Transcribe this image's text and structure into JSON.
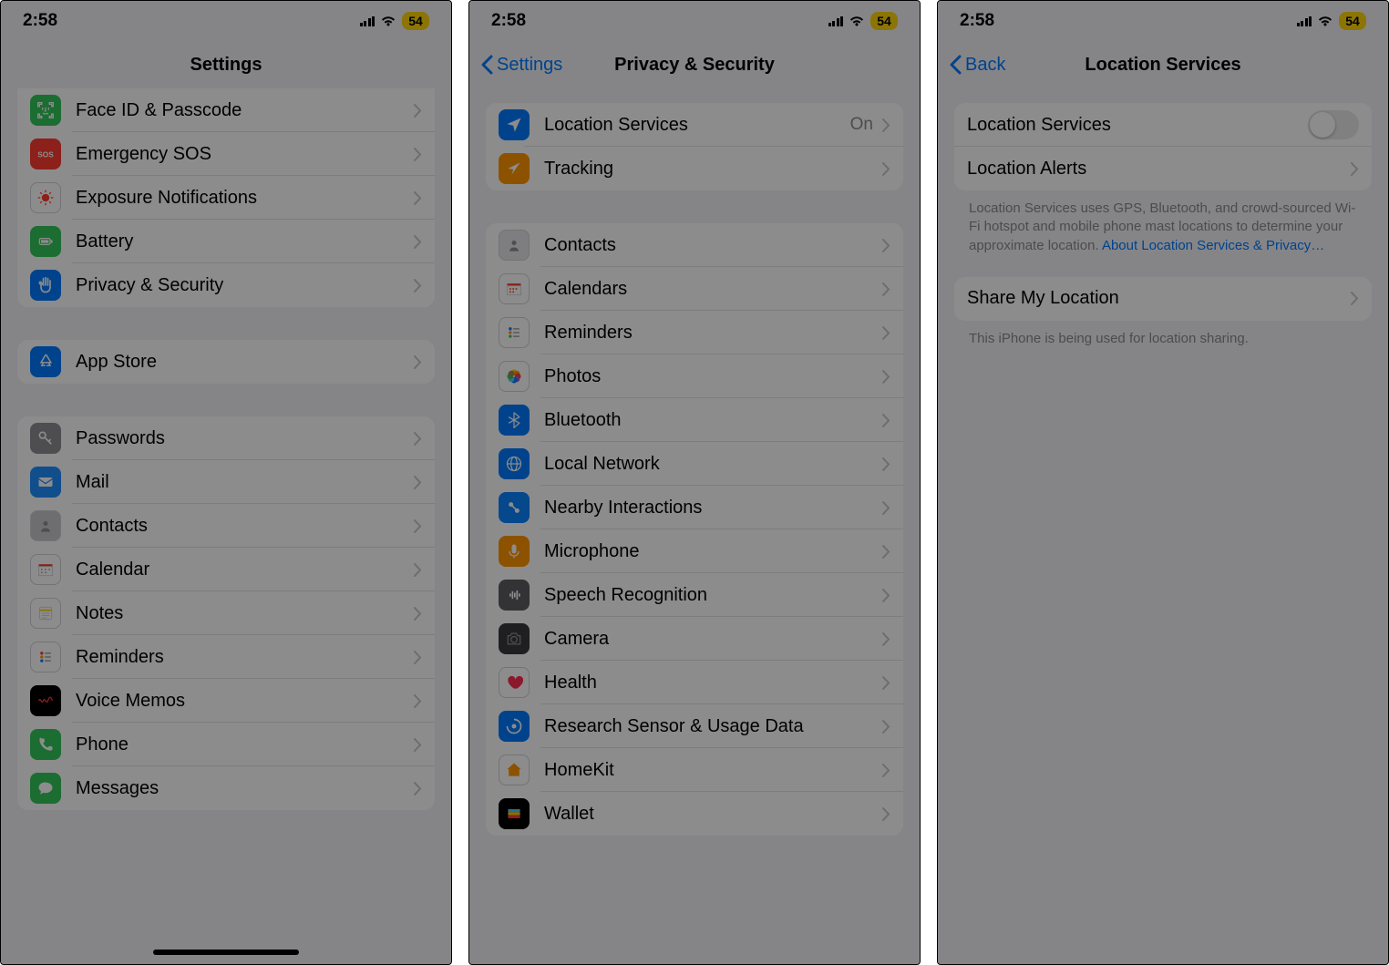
{
  "status": {
    "time": "2:58",
    "battery": "54"
  },
  "screen1": {
    "title": "Settings",
    "group1": [
      {
        "label": "Face ID & Passcode",
        "icon": "faceid",
        "bg": "#34c759",
        "z": false
      },
      {
        "label": "Emergency SOS",
        "icon": "sos",
        "bg": "#ff3b30",
        "z": false
      },
      {
        "label": "Exposure Notifications",
        "icon": "exposure",
        "bg": "#ffffff",
        "z": false
      },
      {
        "label": "Battery",
        "icon": "battery",
        "bg": "#34c759",
        "z": false
      },
      {
        "label": "Privacy & Security",
        "icon": "hand",
        "bg": "#007aff",
        "z": true
      }
    ],
    "group2": [
      {
        "label": "App Store",
        "icon": "appstore",
        "bg": "#007aff"
      }
    ],
    "group3": [
      {
        "label": "Passwords",
        "icon": "key",
        "bg": "#8e8e93"
      },
      {
        "label": "Mail",
        "icon": "mail",
        "bg": "#1f8fff"
      },
      {
        "label": "Contacts",
        "icon": "contacts",
        "bg": "#c9c9ce"
      },
      {
        "label": "Calendar",
        "icon": "calendar",
        "bg": "#ffffff"
      },
      {
        "label": "Notes",
        "icon": "notes",
        "bg": "#ffffff"
      },
      {
        "label": "Reminders",
        "icon": "reminders",
        "bg": "#ffffff"
      },
      {
        "label": "Voice Memos",
        "icon": "voicememos",
        "bg": "#000000"
      },
      {
        "label": "Phone",
        "icon": "phone",
        "bg": "#34c759"
      },
      {
        "label": "Messages",
        "icon": "messages",
        "bg": "#34c759"
      }
    ]
  },
  "screen2": {
    "back": "Settings",
    "title": "Privacy & Security",
    "group1": [
      {
        "label": "Location Services",
        "value": "On",
        "icon": "location",
        "bg": "#007aff",
        "z": true
      },
      {
        "label": "Tracking",
        "icon": "tracking",
        "bg": "#ff9500",
        "z": false
      }
    ],
    "group2": [
      {
        "label": "Contacts",
        "icon": "contacts2",
        "bg": "#e5e5ea"
      },
      {
        "label": "Calendars",
        "icon": "calendars",
        "bg": "#ffffff"
      },
      {
        "label": "Reminders",
        "icon": "reminders2",
        "bg": "#ffffff"
      },
      {
        "label": "Photos",
        "icon": "photos",
        "bg": "#ffffff"
      },
      {
        "label": "Bluetooth",
        "icon": "bluetooth",
        "bg": "#007aff"
      },
      {
        "label": "Local Network",
        "icon": "globe",
        "bg": "#007aff"
      },
      {
        "label": "Nearby Interactions",
        "icon": "nearby",
        "bg": "#0a84ff"
      },
      {
        "label": "Microphone",
        "icon": "mic",
        "bg": "#ff9500"
      },
      {
        "label": "Speech Recognition",
        "icon": "speech",
        "bg": "#5e5e63"
      },
      {
        "label": "Camera",
        "icon": "camera",
        "bg": "#3a3a3c"
      },
      {
        "label": "Health",
        "icon": "health",
        "bg": "#ffffff"
      },
      {
        "label": "Research Sensor & Usage Data",
        "icon": "research",
        "bg": "#007aff"
      },
      {
        "label": "HomeKit",
        "icon": "homekit",
        "bg": "#ffffff"
      },
      {
        "label": "Wallet",
        "icon": "wallet",
        "bg": "#000000"
      }
    ]
  },
  "screen3": {
    "back": "Back",
    "title": "Location Services",
    "toggle_label": "Location Services",
    "alerts": "Location Alerts",
    "footer1": "Location Services uses GPS, Bluetooth, and crowd-sourced Wi-Fi hotspot and mobile phone mast locations to determine your approximate location.",
    "footer_link": "About Location Services & Privacy…",
    "share": "Share My Location",
    "footer2": "This iPhone is being used for location sharing."
  }
}
